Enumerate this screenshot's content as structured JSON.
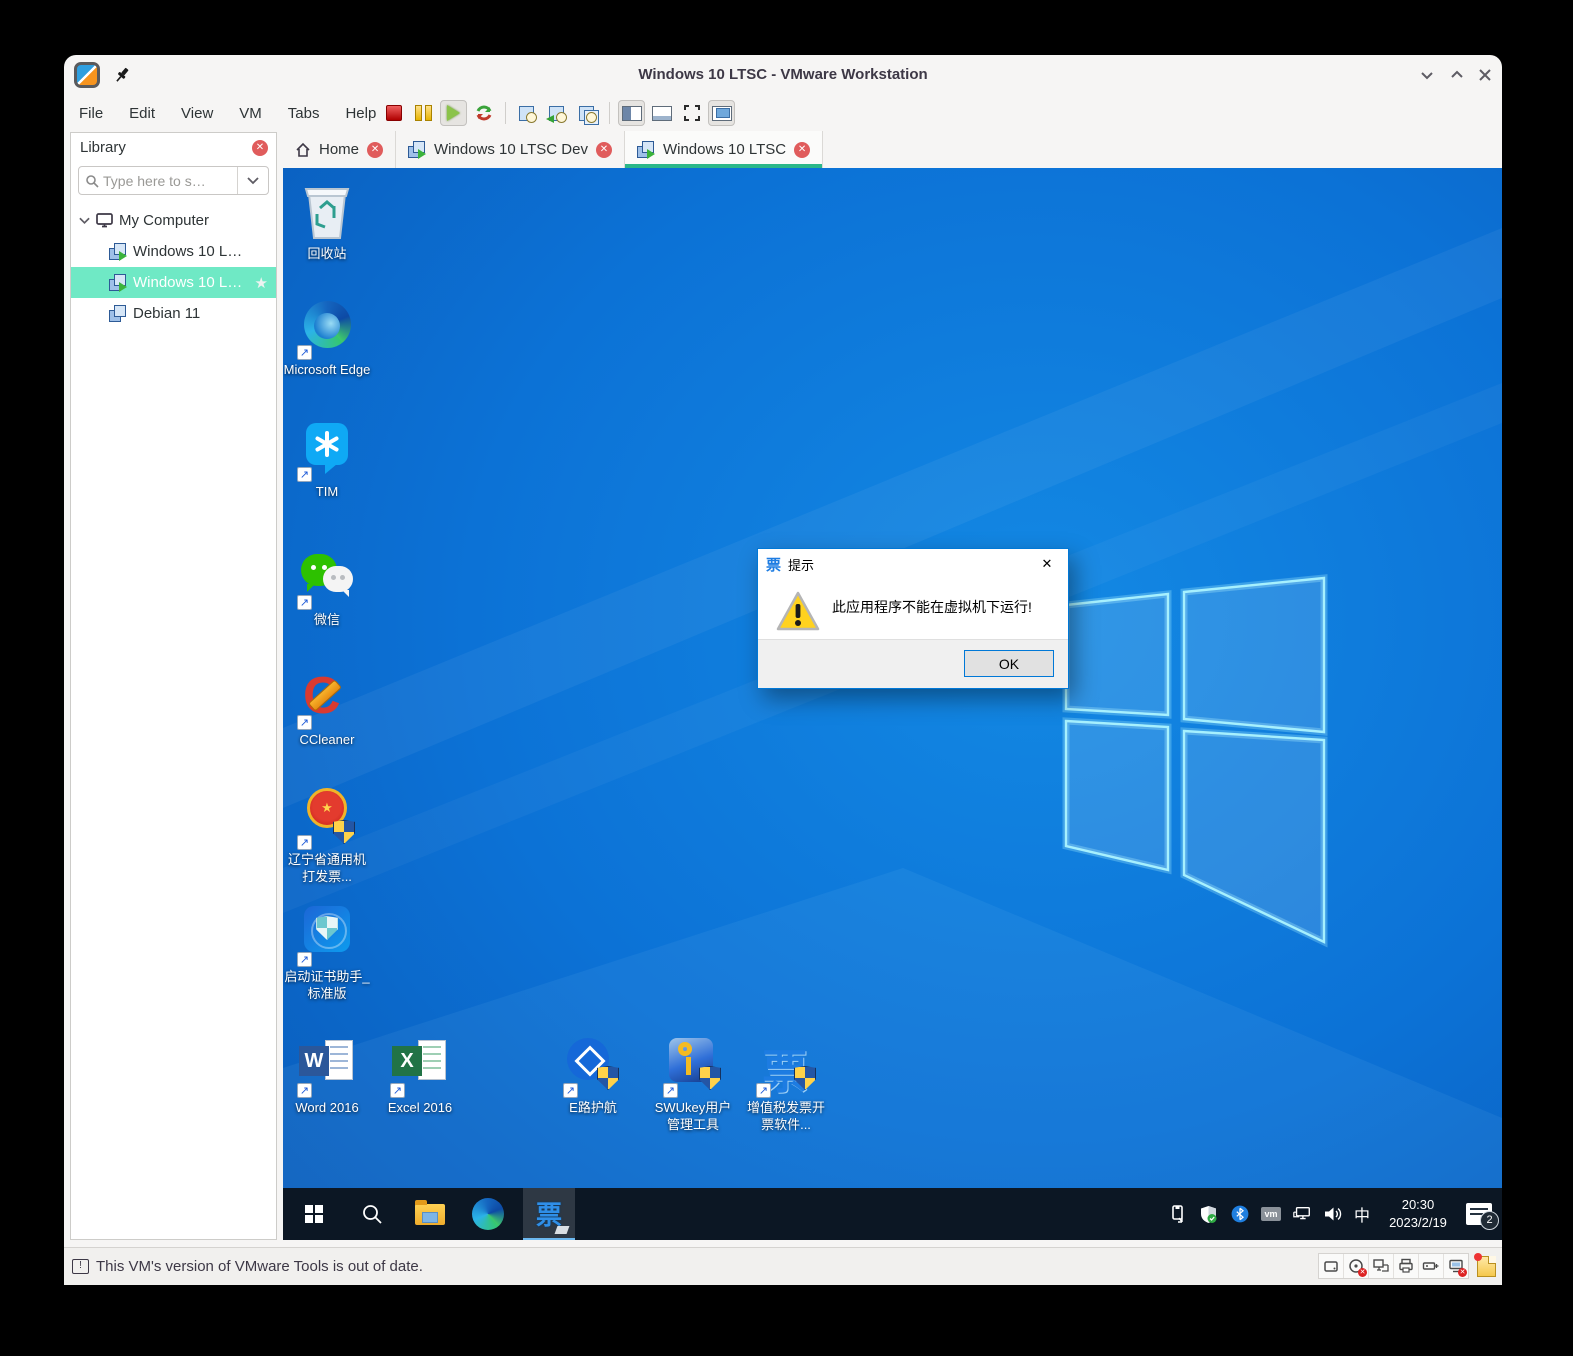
{
  "window": {
    "title": "Windows 10 LTSC - VMware Workstation",
    "menu": {
      "items": [
        "File",
        "Edit",
        "View",
        "VM",
        "Tabs",
        "Help"
      ]
    },
    "toolbar_icons": [
      "stop",
      "pause",
      "play",
      "reset",
      "take-snapshot",
      "revert-snapshot",
      "snapshot-manager",
      "show-library",
      "show-consoles",
      "fullscreen",
      "unity"
    ],
    "controls": [
      "minimize",
      "maximize",
      "close"
    ]
  },
  "tabs": {
    "items": [
      {
        "label": "Home",
        "icon": "home-icon",
        "active": false
      },
      {
        "label": "Windows 10 LTSC Dev",
        "icon": "vm-icon",
        "active": false
      },
      {
        "label": "Windows 10 LTSC",
        "icon": "vm-icon",
        "active": true
      }
    ]
  },
  "library": {
    "title": "Library",
    "search_placeholder": "Type here to s…",
    "tree": [
      {
        "label": "My Computer",
        "icon": "computer-icon",
        "expanded": true
      },
      {
        "label": "Windows 10 L…",
        "icon": "vm-running-icon",
        "selected": false
      },
      {
        "label": "Windows 10 L…",
        "icon": "vm-running-icon",
        "selected": true,
        "favorite": true
      },
      {
        "label": "Debian 11",
        "icon": "vm-icon",
        "selected": false
      }
    ]
  },
  "glyphs": {
    "star": "★",
    "shortcut_arrow": "↗",
    "close_x": "✕",
    "exclaim": "!"
  },
  "desktop": {
    "icons": [
      {
        "label": "回收站"
      },
      {
        "label": "Microsoft Edge"
      },
      {
        "label": "TIM"
      },
      {
        "label": "微信"
      },
      {
        "label": "CCleaner",
        "glyph": "C"
      },
      {
        "label": "辽宁省通用机打发票..."
      },
      {
        "label": "启动证书助手_标准版"
      },
      {
        "label": "Word 2016",
        "glyph": "W"
      },
      {
        "label": "Excel 2016",
        "glyph": "X"
      },
      {
        "label": "E路护航"
      },
      {
        "label": "SWUkey用户管理工具"
      },
      {
        "label": "增值税发票开票软件...",
        "glyph": "票"
      }
    ]
  },
  "dialog": {
    "icon_glyph": "票",
    "title": "提示",
    "message": "此应用程序不能在虚拟机下运行!",
    "ok_label": "OK",
    "border_color": "#0078d7"
  },
  "taskbar": {
    "app_glyph": "票",
    "vm_tray_label": "vm",
    "ime": "中",
    "time": "20:30",
    "date": "2023/2/19",
    "notification_count": "2"
  },
  "statusbar": {
    "message": "This VM's version of VMware Tools is out of date."
  },
  "colors": {
    "accent_teal": "#2bb789",
    "selection_mint": "#6fe9c5",
    "taskbar_bg": "#0c1724",
    "wallpaper_blue": "#0b6fd3",
    "dialog_border": "#0078d7"
  }
}
